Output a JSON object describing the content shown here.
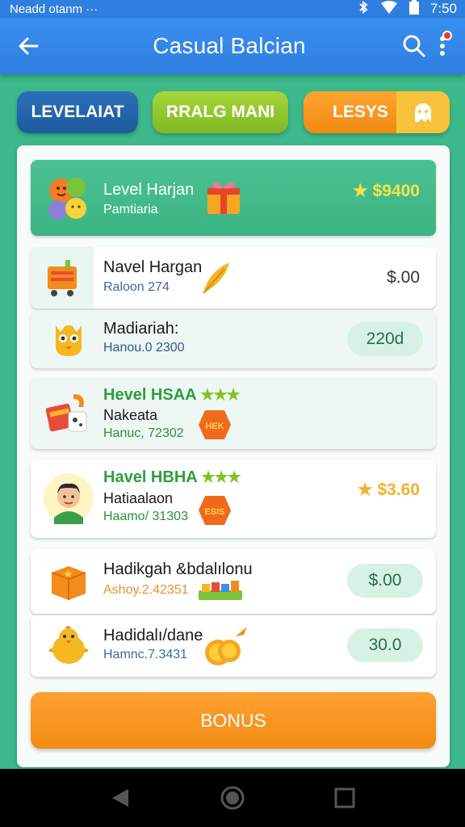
{
  "status_bar": {
    "left_text": "Neadd otanm  ···",
    "time": "7:50"
  },
  "app_bar": {
    "title": "Casual Balcian",
    "back_icon": "arrow-left-icon",
    "search_icon": "search-icon",
    "more_icon": "more-vert-icon"
  },
  "tabs": [
    {
      "label": "LEVELAIAT",
      "color": "#1d5a9e"
    },
    {
      "label": "RRALG MANI",
      "color": "#8cc52c"
    },
    {
      "label": "LESYS",
      "color": "#f5951d",
      "icon": "ghost-icon"
    }
  ],
  "rows": [
    {
      "title": "Level Harjan",
      "subtitle": "Pamtiaria",
      "price": "$9400",
      "price_star": "★",
      "icon": "fruit-bundle-icon",
      "deco": "gift-box-icon"
    },
    {
      "title": "Navel Hargan",
      "subtitle": "Raloon 274",
      "price": "$.00",
      "icon": "shopping-cart-icon",
      "deco": "feather-icon"
    },
    {
      "title": "Madiariah:",
      "subtitle": "Hanou.0 2300",
      "pill": "220d",
      "icon": "owl-mask-icon"
    },
    {
      "title": "Hevel HSAA",
      "stars": "★★★",
      "title_line2": "Nakeata",
      "subtitle": "Hanuc, 72302",
      "icon": "gift-hook-icon",
      "deco": "badge-hex-icon",
      "deco_text": "HEK"
    },
    {
      "title": "Havel HBHA",
      "stars": "★★★",
      "title_line2": "Hatiaalaon",
      "subtitle": "Haamo/ 31303",
      "price": "$3.60",
      "price_star": "★",
      "icon": "avatar-boy-icon",
      "deco": "badge-hex-icon",
      "deco_text": "ESIS"
    },
    {
      "title": "Hadikgah &bdalılonu",
      "subtitle": "Ashoy.2.42351",
      "pill": "$.00",
      "icon": "orange-cube-icon",
      "deco": "building-blocks-icon"
    },
    {
      "title": "Hadidalı/dane",
      "subtitle": "Hamnc.7.3431",
      "pill": "30.0",
      "icon": "chick-icon",
      "deco": "gold-coins-icon"
    }
  ],
  "bonus_button": {
    "label": "BONUS"
  },
  "nav_bar": {
    "back_icon": "nav-back-icon",
    "home_icon": "nav-home-icon",
    "recents_icon": "nav-recents-icon"
  }
}
